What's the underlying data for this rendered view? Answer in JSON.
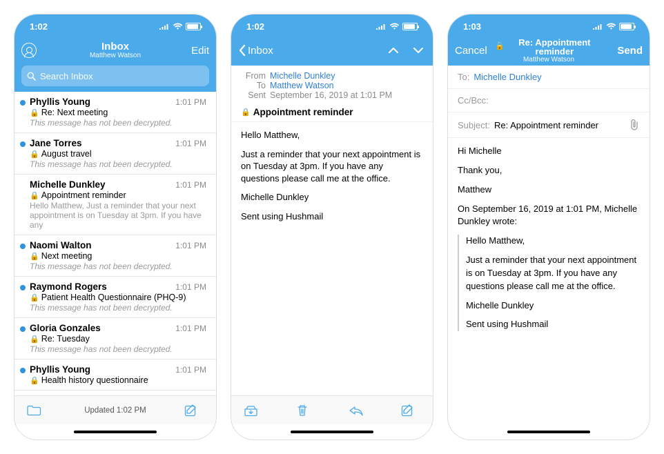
{
  "colors": {
    "accent": "#4baaea",
    "link": "#2f80d8"
  },
  "screen1": {
    "status_time": "1:02",
    "nav_title": "Inbox",
    "nav_subtitle": "Matthew Watson",
    "edit_label": "Edit",
    "search_placeholder": "Search Inbox",
    "updated_label": "Updated 1:02 PM",
    "messages": [
      {
        "sender": "Phyllis Young",
        "time": "1:01 PM",
        "subject": "Re: Next meeting",
        "preview": "This message has not been decrypted.",
        "unread": true,
        "italic": true
      },
      {
        "sender": "Jane Torres",
        "time": "1:01 PM",
        "subject": "August travel",
        "preview": "This message has not been decrypted.",
        "unread": true,
        "italic": true
      },
      {
        "sender": "Michelle Dunkley",
        "time": "1:01 PM",
        "subject": "Appointment reminder",
        "preview": "Hello Matthew,  Just a reminder that your next appointment is on Tuesday at 3pm. If you have any",
        "unread": false,
        "italic": false
      },
      {
        "sender": "Naomi Walton",
        "time": "1:01 PM",
        "subject": "Next meeting",
        "preview": "This message has not been decrypted.",
        "unread": true,
        "italic": true
      },
      {
        "sender": "Raymond Rogers",
        "time": "1:01 PM",
        "subject": "Patient Health Questionnaire (PHQ-9)",
        "preview": "This message has not been decrypted.",
        "unread": true,
        "italic": true
      },
      {
        "sender": "Gloria Gonzales",
        "time": "1:01 PM",
        "subject": "Re: Tuesday",
        "preview": "This message has not been decrypted.",
        "unread": true,
        "italic": true
      },
      {
        "sender": "Phyllis Young",
        "time": "1:01 PM",
        "subject": "Health history questionnaire",
        "preview": "",
        "unread": true,
        "italic": false
      }
    ]
  },
  "screen2": {
    "status_time": "1:02",
    "back_label": "Inbox",
    "from_label": "From",
    "from_value": "Michelle Dunkley",
    "to_label": "To",
    "to_value": "Matthew Watson",
    "sent_label": "Sent",
    "sent_value": "September 16, 2019 at 1:01 PM",
    "subject": "Appointment reminder",
    "body": {
      "p1": "Hello Matthew,",
      "p2": "Just a reminder that your next appointment is on Tuesday at 3pm. If you have any questions please call me at the office.",
      "p3": "Michelle Dunkley",
      "p4": "Sent using Hushmail"
    }
  },
  "screen3": {
    "status_time": "1:03",
    "cancel_label": "Cancel",
    "send_label": "Send",
    "title": "Re: Appointment reminder",
    "subtitle": "Matthew Watson",
    "to_label": "To:",
    "to_value": "Michelle Dunkley",
    "ccbcc_label": "Cc/Bcc:",
    "subject_label": "Subject:",
    "subject_value": "Re: Appointment reminder",
    "body": {
      "p1": "Hi Michelle",
      "p2": "Thank you,",
      "p3": "Matthew",
      "attribution": "On September 16, 2019 at 1:01 PM, Michelle Dunkley wrote:",
      "q1": "Hello Matthew,",
      "q2": "Just a reminder that your next appointment is on Tuesday at 3pm. If you have any questions please call me at the office.",
      "q3": "Michelle Dunkley",
      "q4": "Sent using Hushmail"
    }
  }
}
